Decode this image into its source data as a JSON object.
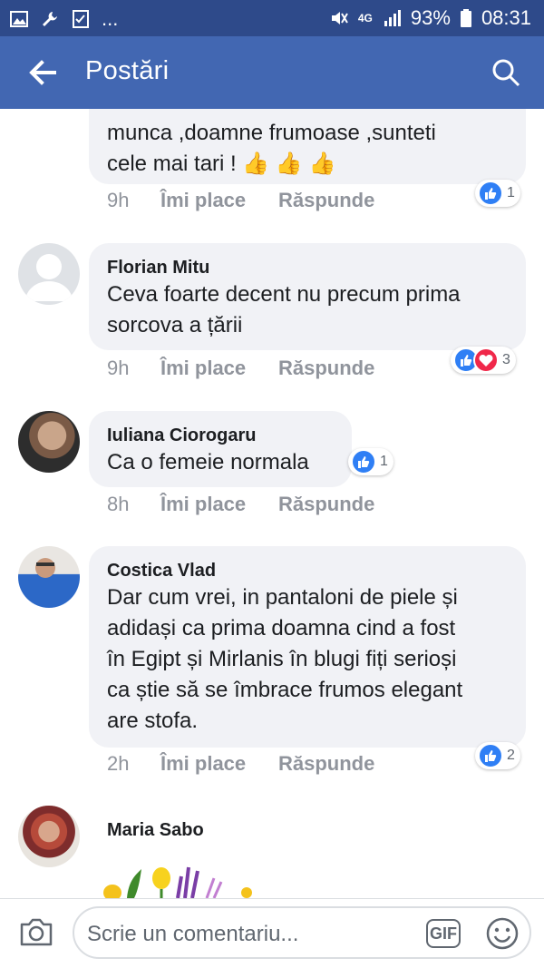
{
  "status_bar": {
    "left_icons": [
      "gallery-icon",
      "wrench-icon",
      "checkbox-icon"
    ],
    "ellipsis": "...",
    "network": "4G",
    "battery": "93%",
    "time": "08:31"
  },
  "header": {
    "title": "Postări",
    "back_icon": "arrow-left-icon",
    "search_icon": "search-icon"
  },
  "comments": [
    {
      "author": "",
      "lines": [
        "munca ,doamne frumoase ,sunteti",
        "cele mai tari ! 👍 👍 👍"
      ],
      "time": "9h",
      "like_label": "Îmi place",
      "reply_label": "Răspunde",
      "reaction_types": [
        "like"
      ],
      "reaction_count": "1"
    },
    {
      "author": "Florian Mitu",
      "lines": [
        "Ceva foarte decent nu precum prima",
        "sorcova a țării"
      ],
      "time": "9h",
      "like_label": "Îmi place",
      "reply_label": "Răspunde",
      "reaction_types": [
        "like",
        "love"
      ],
      "reaction_count": "3"
    },
    {
      "author": "Iuliana Ciorogaru",
      "lines": [
        "Ca o femeie normala"
      ],
      "time": "8h",
      "like_label": "Îmi place",
      "reply_label": "Răspunde",
      "reaction_types": [
        "like"
      ],
      "reaction_count": "1"
    },
    {
      "author": "Costica Vlad",
      "lines": [
        "Dar cum vrei, in pantaloni de piele și",
        "adidași ca prima doamna cind a fost",
        "în Egipt și Mirlanis în blugi fiți serioși",
        "ca știe să se îmbrace frumos elegant",
        "are stofa."
      ],
      "time": "2h",
      "like_label": "Îmi place",
      "reply_label": "Răspunde",
      "reaction_types": [
        "like"
      ],
      "reaction_count": "2"
    },
    {
      "author": "Maria Sabo"
    }
  ],
  "composer": {
    "placeholder": "Scrie un comentariu...",
    "gif_label": "GIF",
    "camera_icon": "camera-icon",
    "emoji_icon": "smiley-icon"
  },
  "colors": {
    "status_bar": "#2e4a8a",
    "app_bar": "#4267b2",
    "bubble": "#f1f2f6",
    "like": "#2f7ff5",
    "love": "#f0284a",
    "meta_text": "#90949c"
  }
}
